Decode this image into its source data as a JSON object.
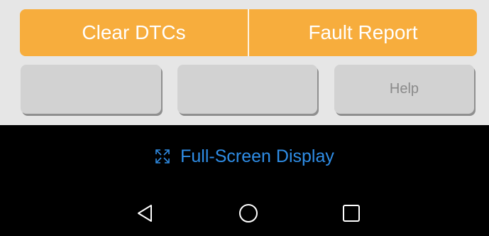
{
  "action_bar": {
    "clear_dtcs_label": "Clear DTCs",
    "fault_report_label": "Fault Report"
  },
  "secondary_buttons": {
    "button1_label": "",
    "button2_label": "",
    "help_label": "Help"
  },
  "fullscreen": {
    "label": "Full-Screen Display",
    "icon": "fullscreen-icon"
  },
  "nav": {
    "back_icon": "back-triangle-icon",
    "home_icon": "home-circle-icon",
    "recent_icon": "recent-apps-square-icon"
  },
  "colors": {
    "accent_orange": "#f7ad3d",
    "button_gray": "#d2d2d2",
    "panel_bg": "#e6e6e6",
    "link_blue": "#2f8de6",
    "background": "#000000"
  }
}
